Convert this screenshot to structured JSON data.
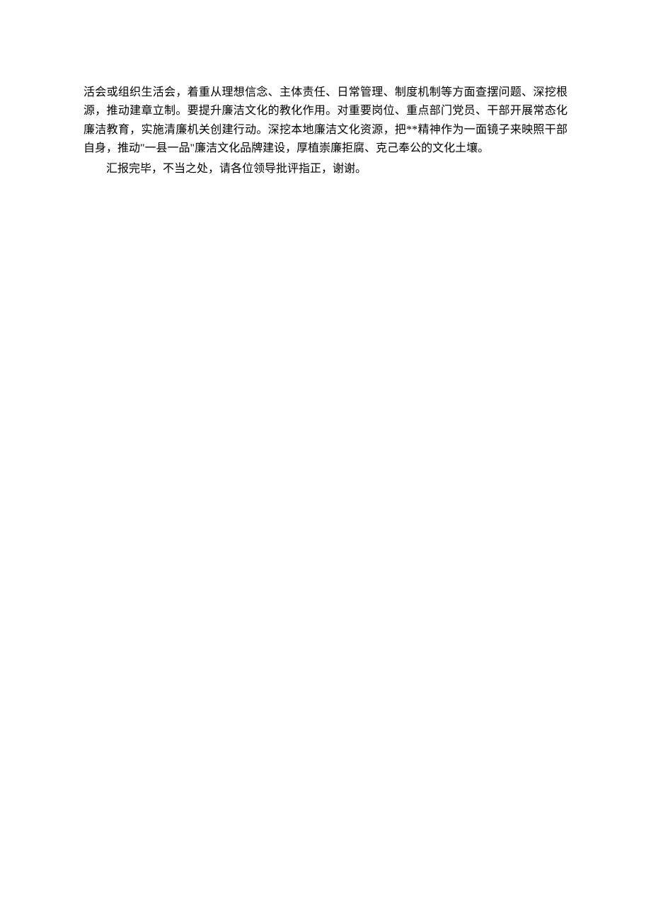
{
  "paragraphs": [
    {
      "text": "活会或组织生活会，着重从理想信念、主体责任、日常管理、制度机制等方面查摆问题、深挖根源，推动建章立制。要提升廉洁文化的教化作用。对重要岗位、重点部门党员、干部开展常态化廉洁教育，实施清廉机关创建行动。深挖本地廉洁文化资源，把**精神作为一面镜子来映照干部自身，推动\"一县一品\"廉洁文化品牌建设，厚植崇廉拒腐、克己奉公的文化土壤。",
      "indent": false
    },
    {
      "text": "汇报完毕，不当之处，请各位领导批评指正，谢谢。",
      "indent": true
    }
  ]
}
